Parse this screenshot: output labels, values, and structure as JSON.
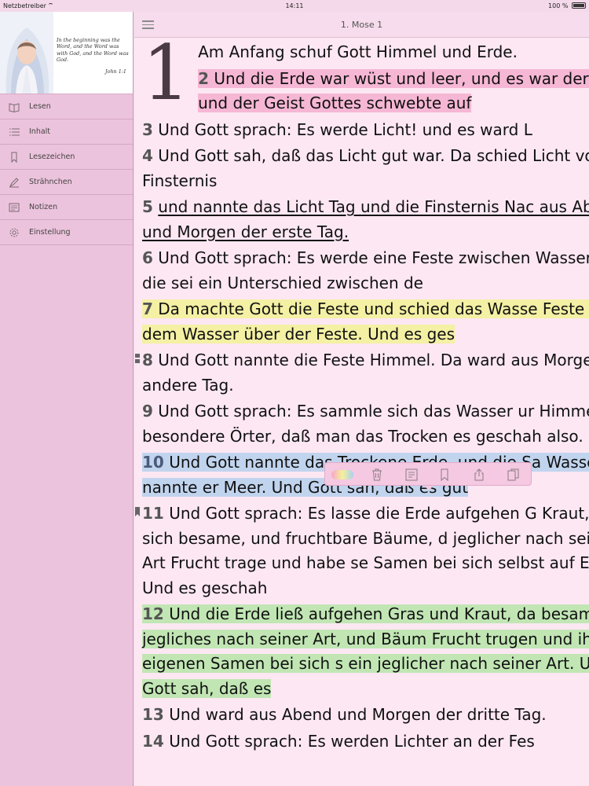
{
  "status": {
    "carrier": "Netzbetreiber",
    "time": "14:11",
    "battery": "100 %"
  },
  "sidebar": {
    "banner": {
      "verse": "In the beginning was the Word, and the Word was with God, and the Word was God.",
      "reference": "John 1:1"
    },
    "items": [
      {
        "label": "Lesen",
        "icon": "book-open-icon"
      },
      {
        "label": "Inhalt",
        "icon": "list-icon"
      },
      {
        "label": "Lesezeichen",
        "icon": "bookmark-icon"
      },
      {
        "label": "Strähnchen",
        "icon": "highlighter-icon"
      },
      {
        "label": "Notizen",
        "icon": "note-icon"
      },
      {
        "label": "Einstellung",
        "icon": "gear-icon"
      }
    ]
  },
  "header": {
    "title": "1. Mose 1"
  },
  "chapter": {
    "number": "1",
    "verses": [
      {
        "n": "",
        "text": "Am Anfang schuf Gott Himmel und Erde."
      },
      {
        "n": "2",
        "text": "Und die Erde war wüst und leer, und es war der Tiefe; und der Geist Gottes schwebte auf"
      },
      {
        "n": "3",
        "text": "Und Gott sprach: Es werde Licht! und es ward L"
      },
      {
        "n": "4",
        "text": "Und Gott sah, daß das Licht gut war. Da schied Licht von der Finsternis"
      },
      {
        "n": "5",
        "text": "und nannte das Licht Tag und die Finsternis Nac aus Abend und Morgen der erste Tag."
      },
      {
        "n": "6",
        "text": "Und Gott sprach: Es werde eine Feste zwischen Wassern, und die sei ein Unterschied zwischen de"
      },
      {
        "n": "7",
        "text": "Da machte Gott die Feste und schied das Wasse Feste von dem Wasser über der Feste. Und es ges"
      },
      {
        "n": "8",
        "text": "Und Gott nannte die Feste Himmel. Da ward aus Morgen der andere Tag."
      },
      {
        "n": "9",
        "text": "Und Gott sprach: Es sammle sich das Wasser ur Himmel an besondere Örter, daß man das Trocken es geschah also."
      },
      {
        "n": "10",
        "text": "Und Gott nannte das Trockene Erde, und die Sa Wasser nannte er Meer. Und Gott sah, daß es gut"
      },
      {
        "n": "11",
        "text": "Und Gott sprach: Es lasse die Erde aufgehen G Kraut, das sich besame, und fruchtbare Bäume, d jeglicher nach seiner Art Frucht trage und habe se Samen bei sich selbst auf Erden. Und es geschah"
      },
      {
        "n": "12",
        "text": "Und die Erde ließ aufgehen Gras und Kraut, da besamte, ein jegliches nach seiner Art, und Bäum Frucht trugen und ihren eigenen Samen bei sich s ein jeglicher nach seiner Art. Und Gott sah, daß es"
      },
      {
        "n": "13",
        "text": "Und ward aus Abend und Morgen der dritte Tag."
      },
      {
        "n": "14",
        "text": "Und Gott sprach: Es werden Lichter an der Fes"
      }
    ]
  },
  "highlight_colors": {
    "pink": "#f6b7d5",
    "yellow": "#f4f0a4",
    "blue": "#c1d4ee",
    "green": "#c1e6b4"
  },
  "toolbar": [
    "color-picker-icon",
    "trash-icon",
    "note-icon",
    "bookmark-icon",
    "share-icon",
    "copy-icon"
  ]
}
